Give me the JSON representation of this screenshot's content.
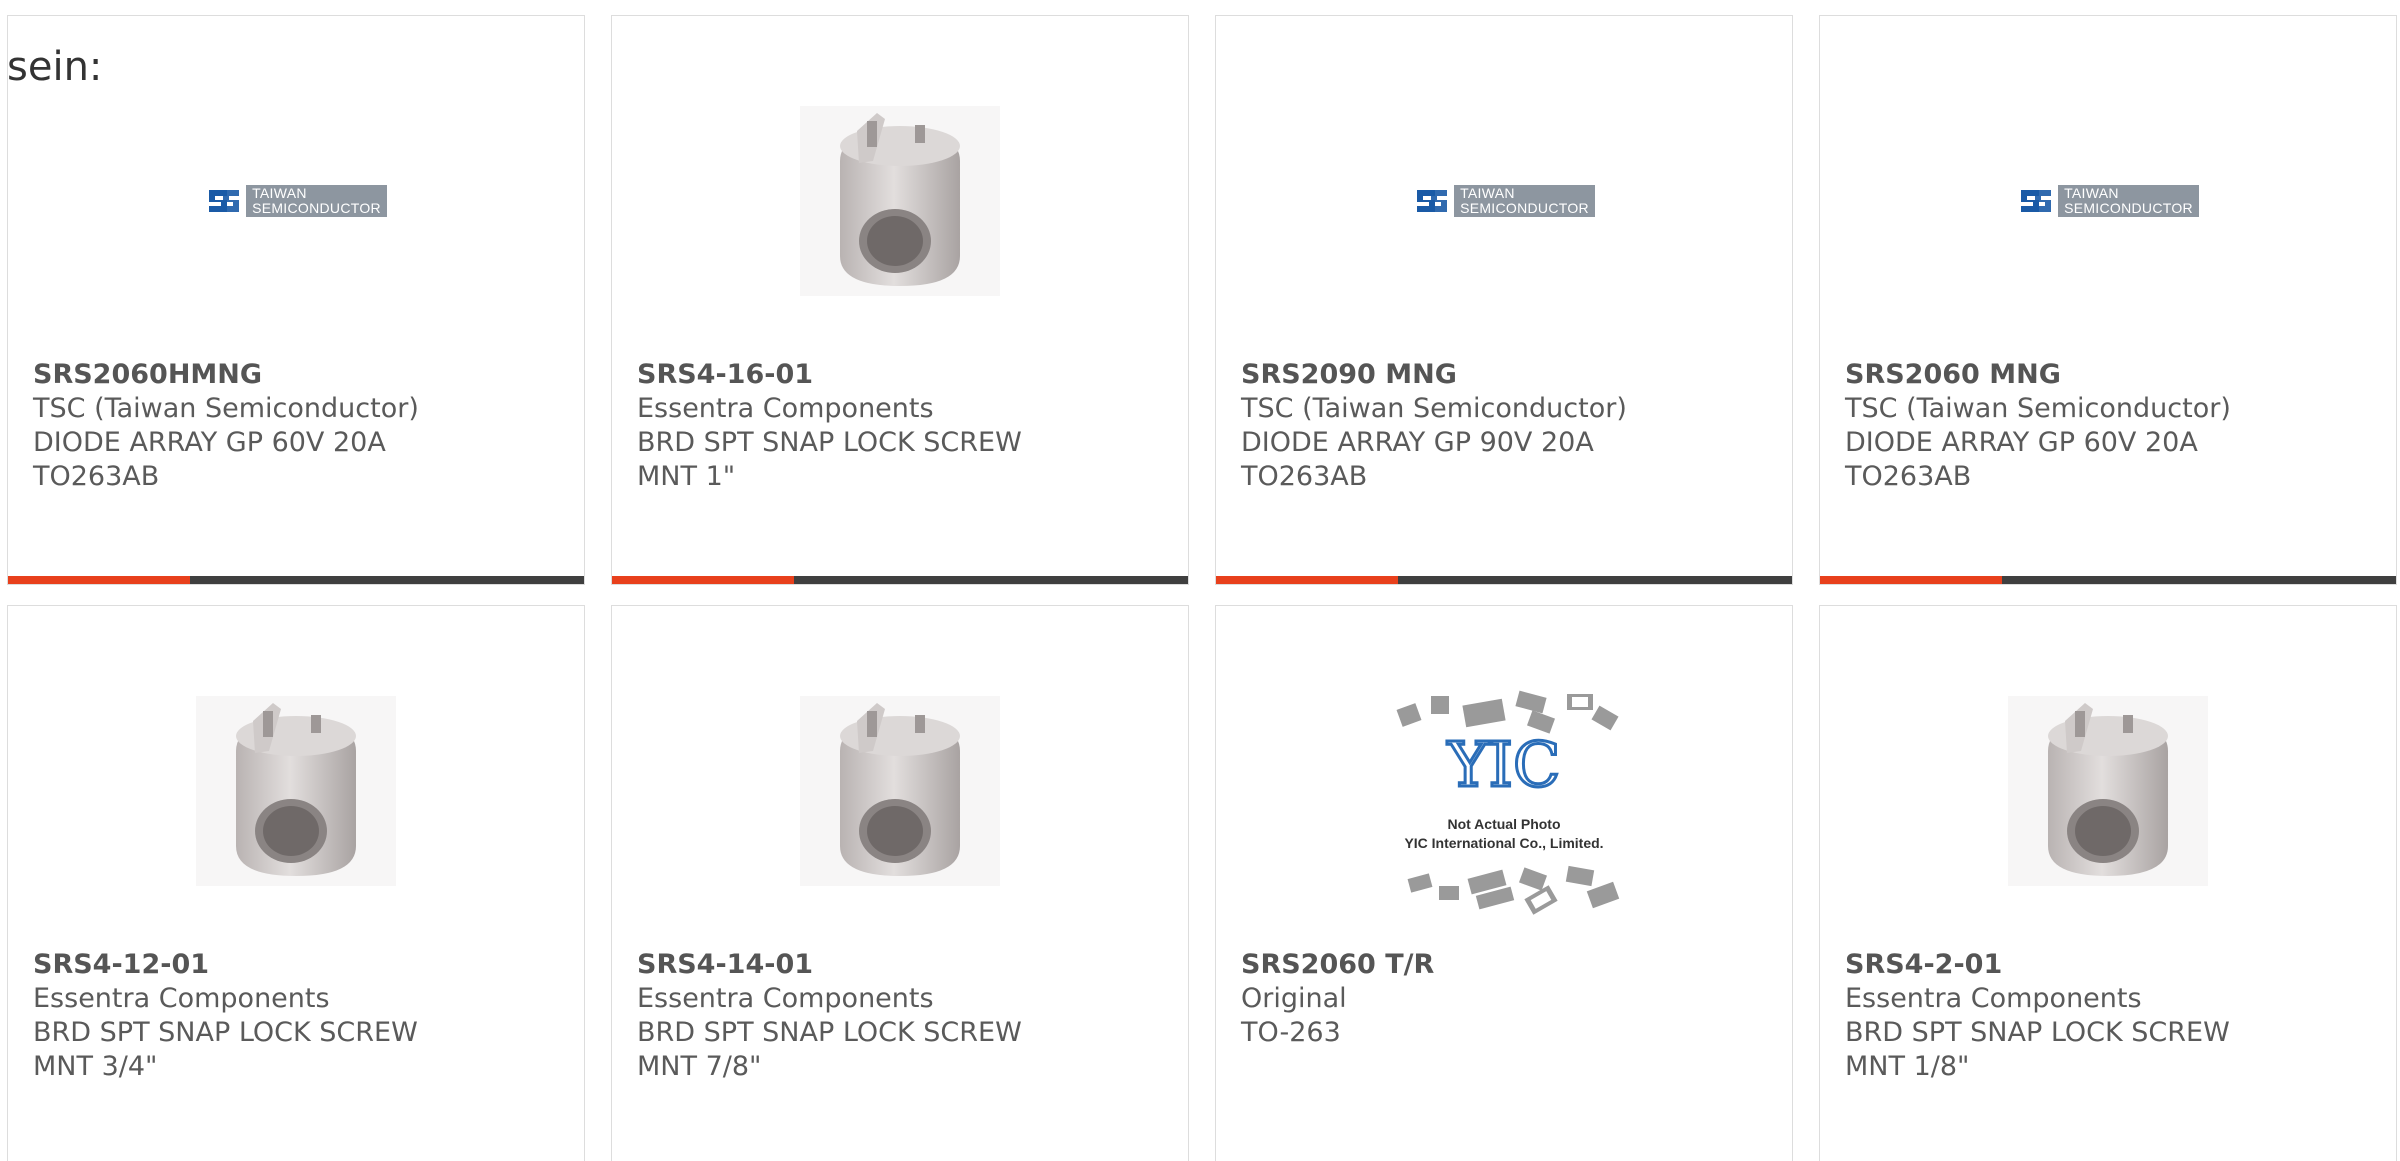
{
  "page": {
    "lead_text": "sein:"
  },
  "colors": {
    "accent": "#e8401c",
    "bar": "#3f3f3f",
    "text": "#5a5a5a",
    "border": "#dddddd"
  },
  "products": [
    {
      "part_number": "SRS2060HMNG",
      "manufacturer": "TSC (Taiwan Semiconductor)",
      "description": "DIODE ARRAY GP 60V 20A\nTO263AB",
      "image": "taiwan-semiconductor-logo"
    },
    {
      "part_number": "SRS4-16-01",
      "manufacturer": "Essentra Components",
      "description": "BRD SPT SNAP LOCK SCREW\nMNT 1\"",
      "image": "snap-lock-mount-photo"
    },
    {
      "part_number": "SRS2090 MNG",
      "manufacturer": "TSC (Taiwan Semiconductor)",
      "description": "DIODE ARRAY GP 90V 20A\nTO263AB",
      "image": "taiwan-semiconductor-logo"
    },
    {
      "part_number": "SRS2060 MNG",
      "manufacturer": "TSC (Taiwan Semiconductor)",
      "description": "DIODE ARRAY GP 60V 20A\nTO263AB",
      "image": "taiwan-semiconductor-logo"
    },
    {
      "part_number": "SRS4-12-01",
      "manufacturer": "Essentra Components",
      "description": "BRD SPT SNAP LOCK SCREW\nMNT 3/4\"",
      "image": "snap-lock-mount-photo"
    },
    {
      "part_number": "SRS4-14-01",
      "manufacturer": "Essentra Components",
      "description": "BRD SPT SNAP LOCK SCREW\nMNT 7/8\"",
      "image": "snap-lock-mount-photo"
    },
    {
      "part_number": "SRS2060 T/R",
      "manufacturer": "Original",
      "description": "TO-263",
      "image": "yic-placeholder-photo"
    },
    {
      "part_number": "SRS4-2-01",
      "manufacturer": "Essentra Components",
      "description": "BRD SPT SNAP LOCK SCREW\nMNT 1/8\"",
      "image": "snap-lock-mount-photo"
    }
  ],
  "logos": {
    "tsc_line1": "TAIWAN",
    "tsc_line2": "SEMICONDUCTOR",
    "yic_mark": "YIC",
    "yic_line1": "Not Actual Photo",
    "yic_line2": "YIC International Co., Limited."
  }
}
